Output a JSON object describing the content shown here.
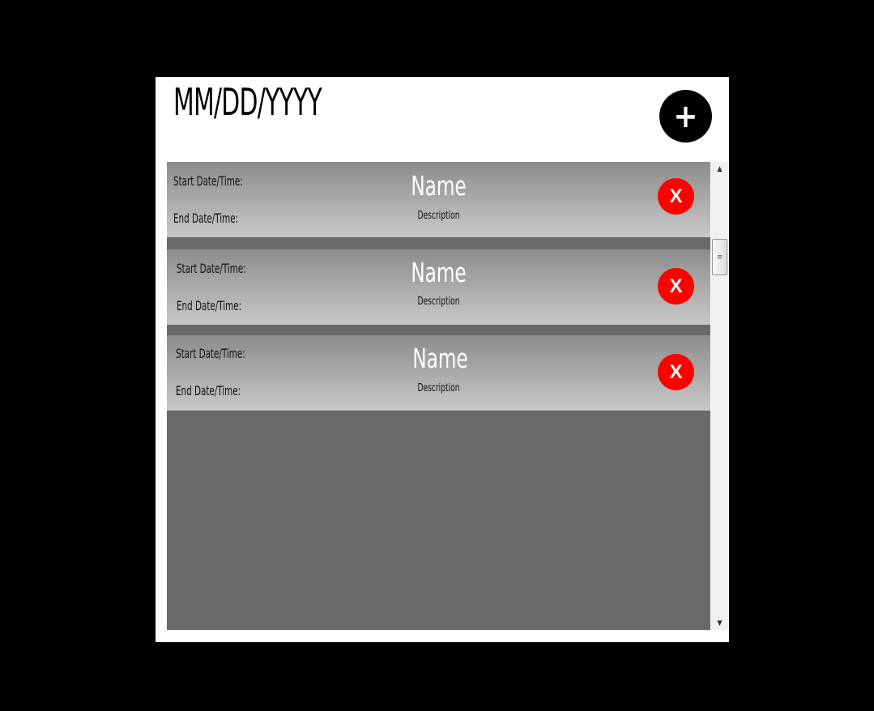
{
  "header": {
    "date_placeholder": "MM/DD/YYYY",
    "add_label": "+"
  },
  "events": [
    {
      "start_label": "Start Date/Time:",
      "end_label": "End Date/Time:",
      "name": "Name",
      "description": "Description",
      "delete_label": "X"
    },
    {
      "start_label": "Start Date/Time:",
      "end_label": "End Date/Time:",
      "name": "Name",
      "description": "Description",
      "delete_label": "X"
    },
    {
      "start_label": "Start Date/Time:",
      "end_label": "End Date/Time:",
      "name": "Name",
      "description": "Description",
      "delete_label": "X"
    }
  ],
  "scrollbar": {
    "up_arrow": "▲",
    "down_arrow": "▼",
    "thumb_grip": "≡"
  },
  "colors": {
    "delete": "#ff0000",
    "add": "#000000",
    "list_bg": "#696969"
  }
}
